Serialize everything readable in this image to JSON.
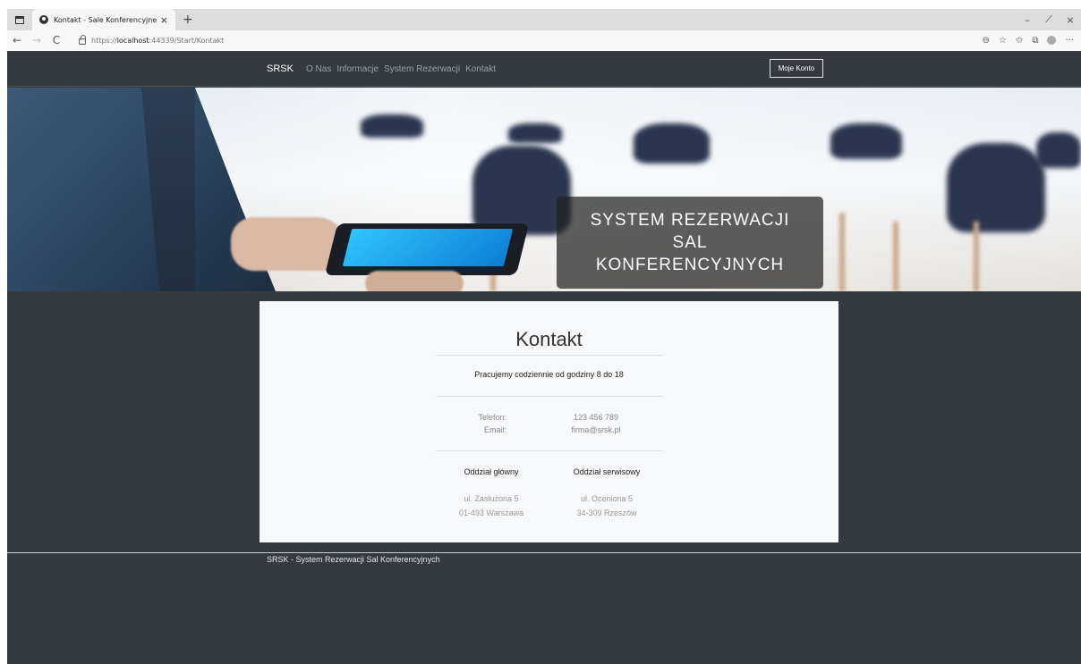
{
  "browser": {
    "tab_title": "Kontakt - Sale Konferencyjne",
    "tab_close": "×",
    "new_tab": "+",
    "url_prefix": "https://",
    "url_host": "localhost",
    "url_rest": ":44339/Start/Kontakt",
    "win_min": "–",
    "win_max": "⟋",
    "win_close": "×",
    "back": "←",
    "forward": "→",
    "refresh": "C",
    "zoom_icon": "⊖",
    "read_icon": "☆",
    "fav_icon": "✩",
    "collections_icon": "⧉",
    "more": "···"
  },
  "navbar": {
    "brand": "SRSK",
    "links": [
      "O Nas",
      "Informacje",
      "System Rezerwacji",
      "Kontakt"
    ],
    "account": "Moje Konto"
  },
  "hero": {
    "line1": "SYSTEM REZERWACJI",
    "line2": "SAL",
    "line3": "KONFERENCYJNYCH"
  },
  "contact": {
    "title": "Kontakt",
    "hours": "Pracujemy codziennie od godziny 8 do 18",
    "phone_label": "Telefon:",
    "phone_value": "123 456 789",
    "email_label": "Email:",
    "email_value": "firma@srsk.pl",
    "branches": [
      {
        "name": "Oddział główny",
        "street": "ul. Zasłużona 5",
        "city": "01-493 Warszawa"
      },
      {
        "name": "Oddział serwisowy",
        "street": "ul. Oceniona 5",
        "city": "34-309 Rzeszów"
      }
    ]
  },
  "footer": {
    "text": "SRSK - System Rezerwacji Sal Konferencyjnych"
  }
}
